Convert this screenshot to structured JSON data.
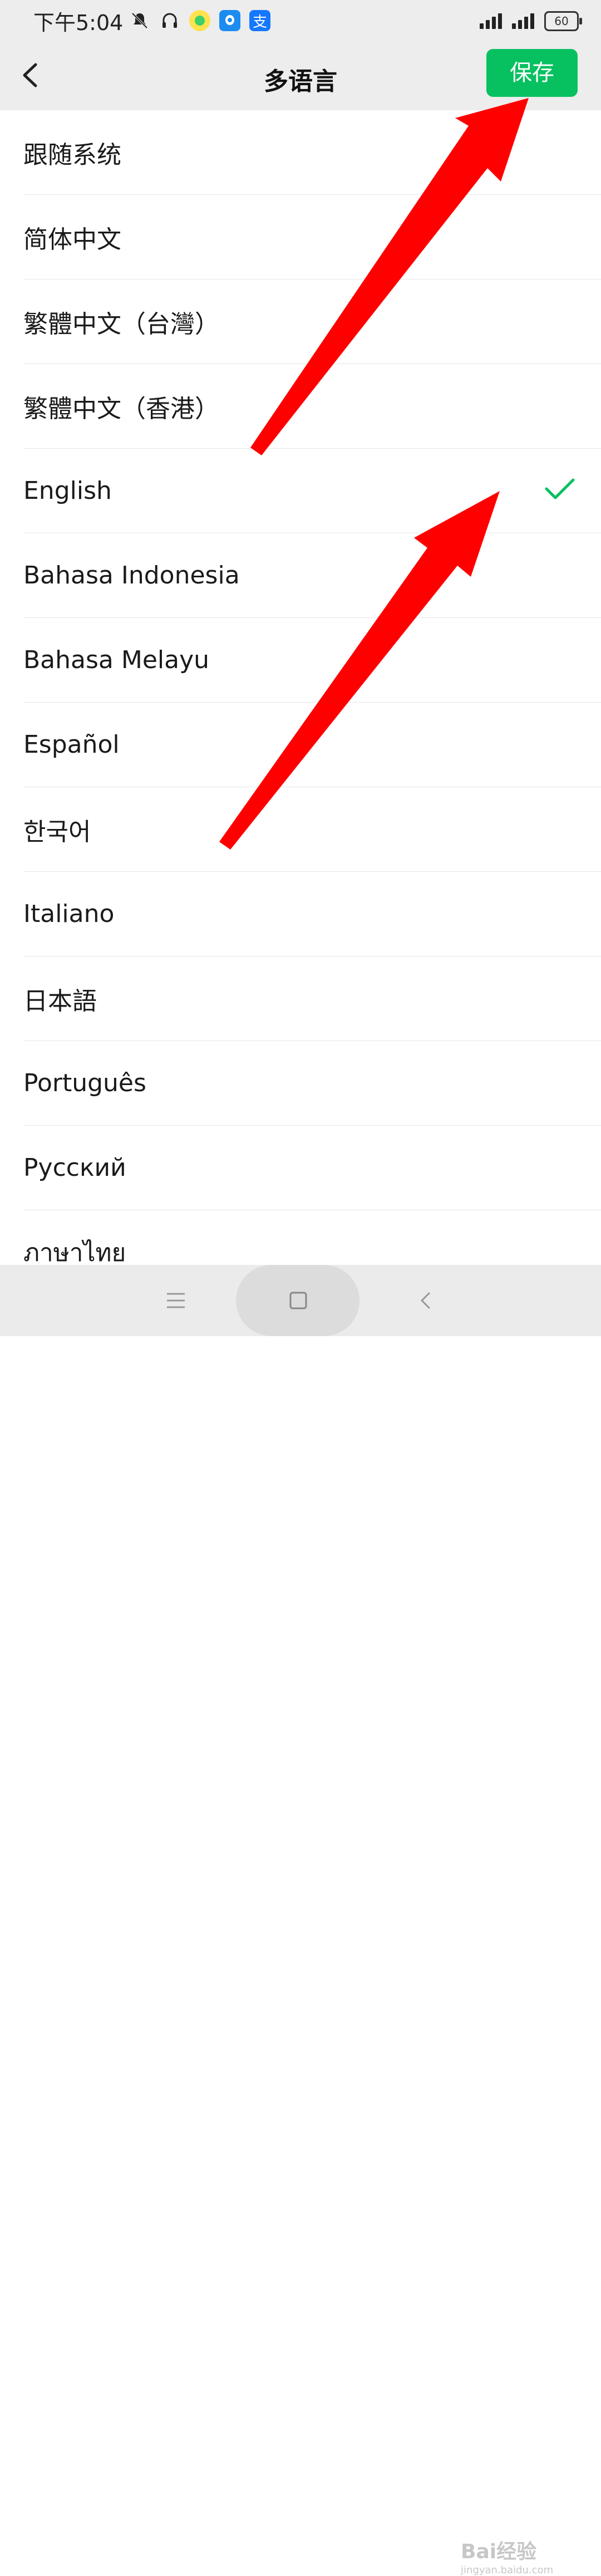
{
  "status_bar": {
    "time": "下午5:04",
    "battery": "60"
  },
  "nav": {
    "title": "多语言",
    "save_label": "保存"
  },
  "languages": [
    {
      "label": "跟随系统",
      "selected": false
    },
    {
      "label": "简体中文",
      "selected": false
    },
    {
      "label": "繁體中文（台灣）",
      "selected": false
    },
    {
      "label": "繁體中文（香港）",
      "selected": false
    },
    {
      "label": "English",
      "selected": true
    },
    {
      "label": "Bahasa Indonesia",
      "selected": false
    },
    {
      "label": "Bahasa Melayu",
      "selected": false
    },
    {
      "label": "Español",
      "selected": false
    },
    {
      "label": "한국어",
      "selected": false
    },
    {
      "label": "Italiano",
      "selected": false
    },
    {
      "label": "日本語",
      "selected": false
    },
    {
      "label": "Português",
      "selected": false
    },
    {
      "label": "Русский",
      "selected": false
    },
    {
      "label": "ภาษาไทย",
      "selected": false
    }
  ],
  "watermark": {
    "brand": "Bai经验",
    "url": "jingyan.baidu.com"
  },
  "colors": {
    "accent": "#07c160",
    "annotation": "#ff0000"
  }
}
